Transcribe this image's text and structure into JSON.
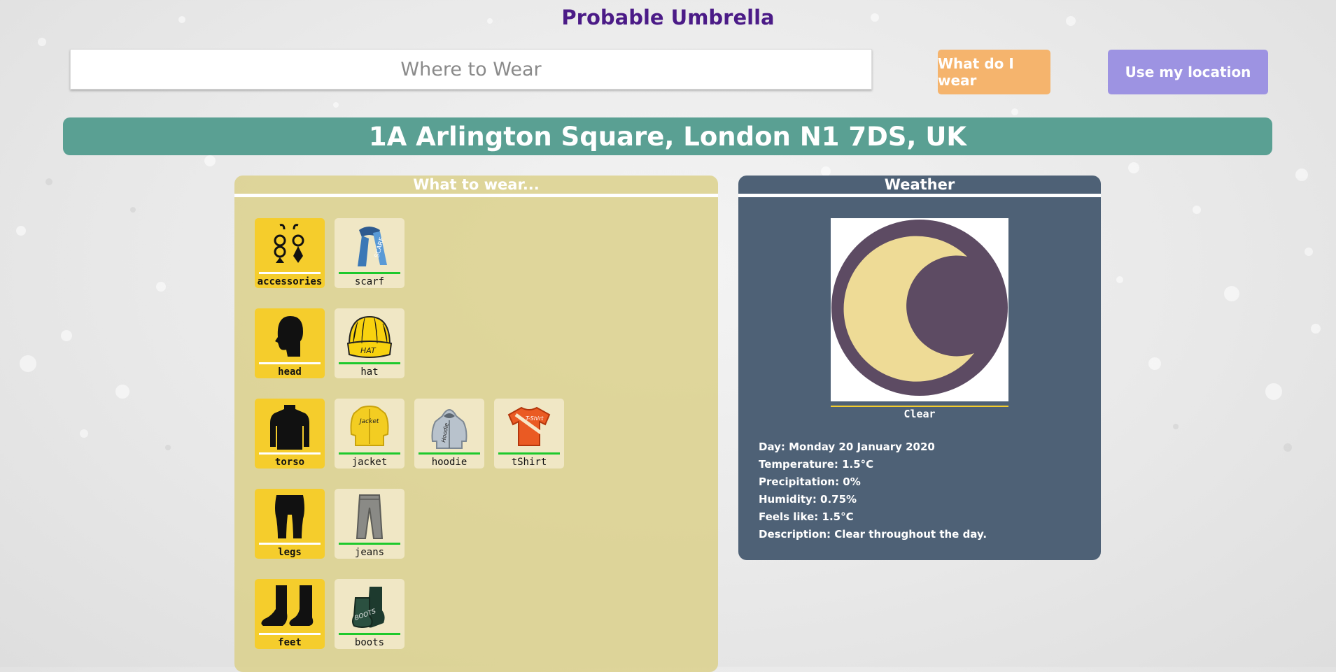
{
  "app": {
    "title": "Probable Umbrella"
  },
  "search": {
    "placeholder": "Where to Wear",
    "value": ""
  },
  "buttons": {
    "what_to_wear": "What do I wear",
    "use_location": "Use my location"
  },
  "address": "1A Arlington Square, London N1 7DS, UK",
  "wear": {
    "heading": "What to wear...",
    "rows": [
      {
        "category": "accessories",
        "items": [
          "scarf"
        ]
      },
      {
        "category": "head",
        "items": [
          "hat"
        ]
      },
      {
        "category": "torso",
        "items": [
          "jacket",
          "hoodie",
          "tShirt"
        ]
      },
      {
        "category": "legs",
        "items": [
          "jeans"
        ]
      },
      {
        "category": "feet",
        "items": [
          "boots"
        ]
      }
    ]
  },
  "weather": {
    "heading": "Weather",
    "condition": "Clear",
    "icon": "moon-icon",
    "day": "Day: Monday 20 January 2020",
    "temperature": "Temperature: 1.5°C",
    "precipitation": "Precipitation: 0%",
    "humidity": "Humidity: 0.75%",
    "feels_like": "Feels like: 1.5°C",
    "description": "Description: Clear throughout the day."
  },
  "colors": {
    "title": "#4b1b87",
    "wear_button": "#f5b46d",
    "location_button": "#9d93e2",
    "address_bar": "#5aa093",
    "wear_panel": "#dbd087",
    "weather_panel": "#4e6176",
    "category_tile": "#f5cd2c",
    "item_tile": "#f0e7c5",
    "item_underline": "#1ec92c"
  }
}
